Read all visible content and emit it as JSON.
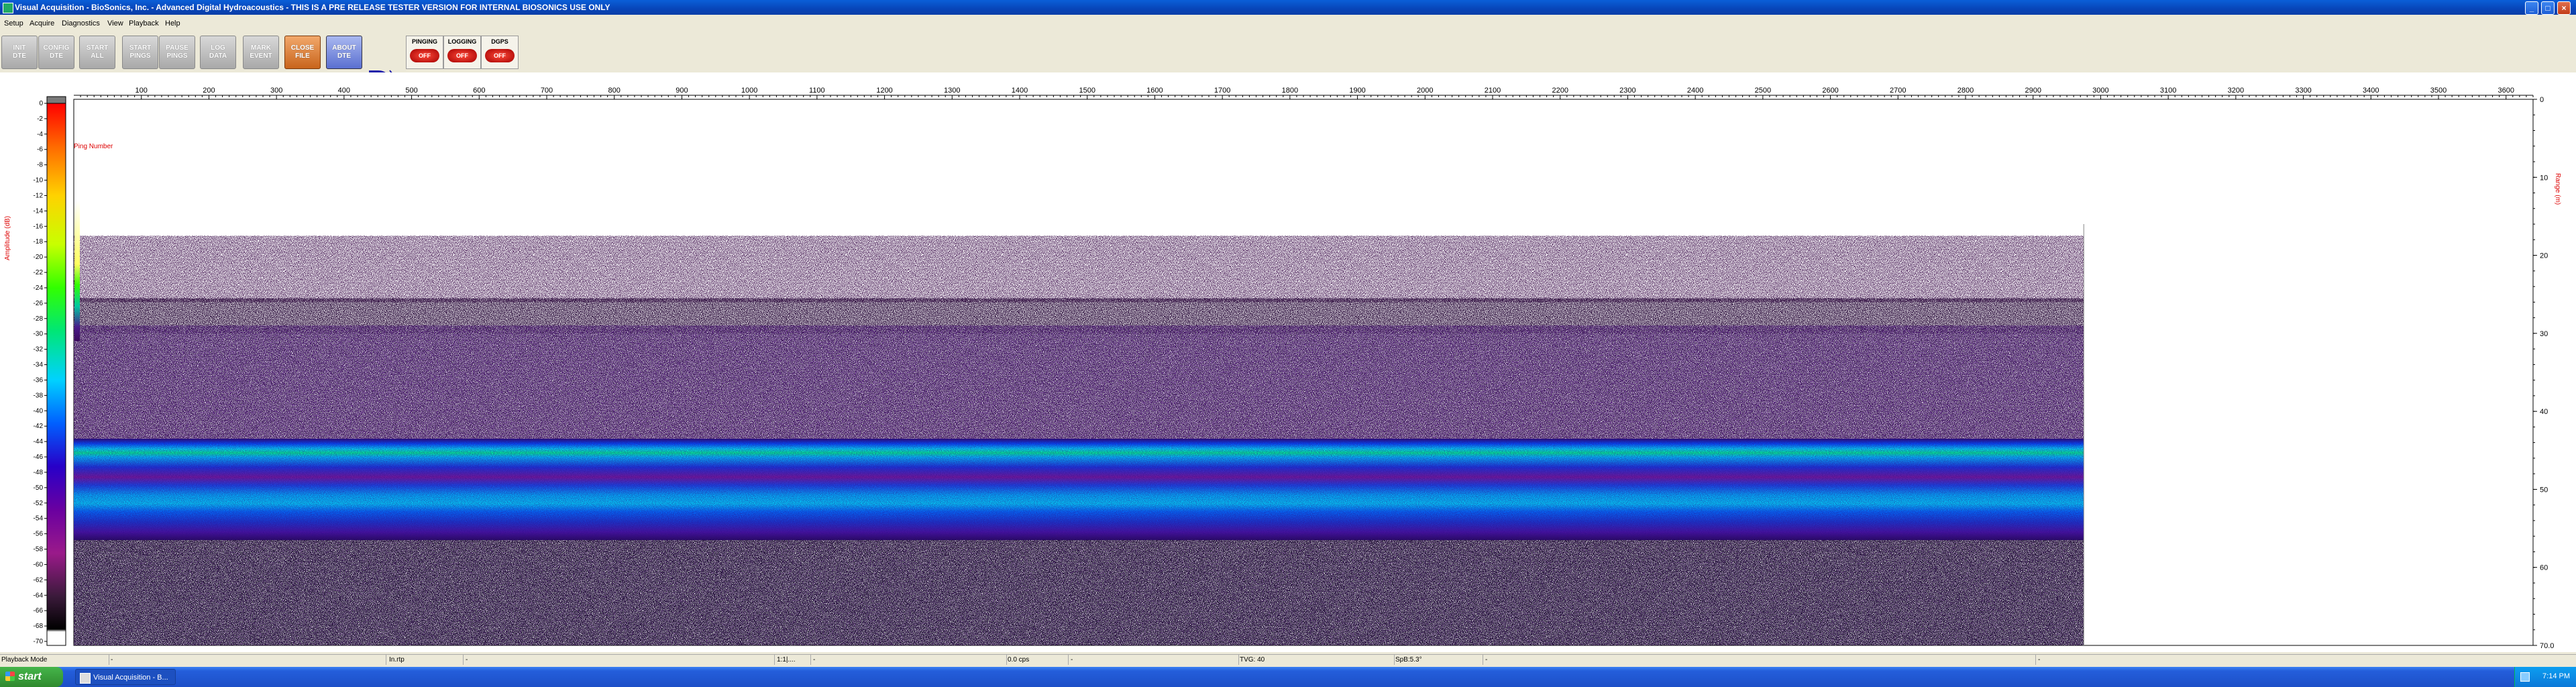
{
  "window": {
    "title": "Visual Acquisition  -  BioSonics, Inc.  -  Advanced Digital Hydroacoustics  -  THIS IS A PRE RELEASE TESTER VERSION FOR INTERNAL BIOSONICS USE ONLY",
    "minimize": "_",
    "maximize": "□",
    "close": "×"
  },
  "menu": [
    "Setup",
    "Acquire",
    "Diagnostics",
    "View",
    "Playback",
    "Help"
  ],
  "toolbar": {
    "buttons": [
      {
        "id": "init-dte",
        "label": "INIT\nDTE"
      },
      {
        "id": "config-dte",
        "label": "CONFIG\nDTE"
      },
      {
        "id": "start-all",
        "label": "START\nALL"
      },
      {
        "id": "start-pings",
        "label": "START\nPINGS"
      },
      {
        "id": "pause-pings",
        "label": "PAUSE\nPINGS"
      },
      {
        "id": "log-data",
        "label": "LOG\nDATA"
      },
      {
        "id": "mark-event",
        "label": "MARK\nEVENT"
      },
      {
        "id": "close-file",
        "label": "CLOSE\nFILE"
      },
      {
        "id": "about-dte",
        "label": "ABOUT\nDTE"
      }
    ],
    "indicators": [
      {
        "label": "PINGING",
        "value": "OFF"
      },
      {
        "label": "LOGGING",
        "value": "OFF"
      },
      {
        "label": "DGPS",
        "value": "OFF"
      }
    ]
  },
  "echogram": {
    "ping_axis_title": "Ping Number",
    "ping_ticks": [
      100,
      200,
      300,
      400,
      500,
      600,
      700,
      800,
      900,
      1000,
      1100,
      1200,
      1300,
      1400,
      1500,
      1600,
      1700,
      1800,
      1900,
      2000,
      2100,
      2200,
      2300,
      2400,
      2500,
      2600,
      2700,
      2800,
      2900,
      3000,
      3100,
      3200,
      3300,
      3400,
      3500,
      3600
    ],
    "ping_range": [
      0,
      3640
    ],
    "pings_recorded": 2975,
    "depth_axis_title": "Range (m)",
    "depth_ticks": [
      "0",
      "10",
      "20",
      "30",
      "40",
      "50",
      "60",
      "70.0"
    ],
    "depth_range": [
      0,
      70
    ],
    "colorbar_title": "Amplitude (dB)",
    "colorbar_ticks": [
      "0",
      "-2",
      "-4",
      "-6",
      "-8",
      "-10",
      "-12",
      "-14",
      "-16",
      "-18",
      "-20",
      "-22",
      "-24",
      "-26",
      "-28",
      "-30",
      "-32",
      "-34",
      "-36",
      "-38",
      "-40",
      "-42",
      "-44",
      "-46",
      "-48",
      "-50",
      "-52",
      "-54",
      "-56",
      "-58",
      "-60",
      "-62",
      "-64",
      "-66",
      "-68",
      "-70"
    ],
    "colorbar_range": [
      0,
      -70
    ],
    "colorbar_colors": [
      "#7a7a7a",
      "#ff0000",
      "#ff6a00",
      "#ffd200",
      "#c8ff00",
      "#32ff00",
      "#00e676",
      "#00d2ff",
      "#0060ff",
      "#2800c8",
      "#6a00a0",
      "#9a1a8a",
      "#5a2a5a",
      "#000000",
      "#ffffff"
    ]
  },
  "statusbar": [
    "Playback Mode",
    "-",
    "In.rtp",
    "-",
    "1:1|....",
    "-",
    "0.0 cps",
    "-",
    "TVG: 40",
    "SpB:5.3°",
    "-",
    "-"
  ],
  "taskbar": {
    "start": "start",
    "task": "Visual Acquisition  -  B...",
    "clock": "7:14 PM"
  }
}
